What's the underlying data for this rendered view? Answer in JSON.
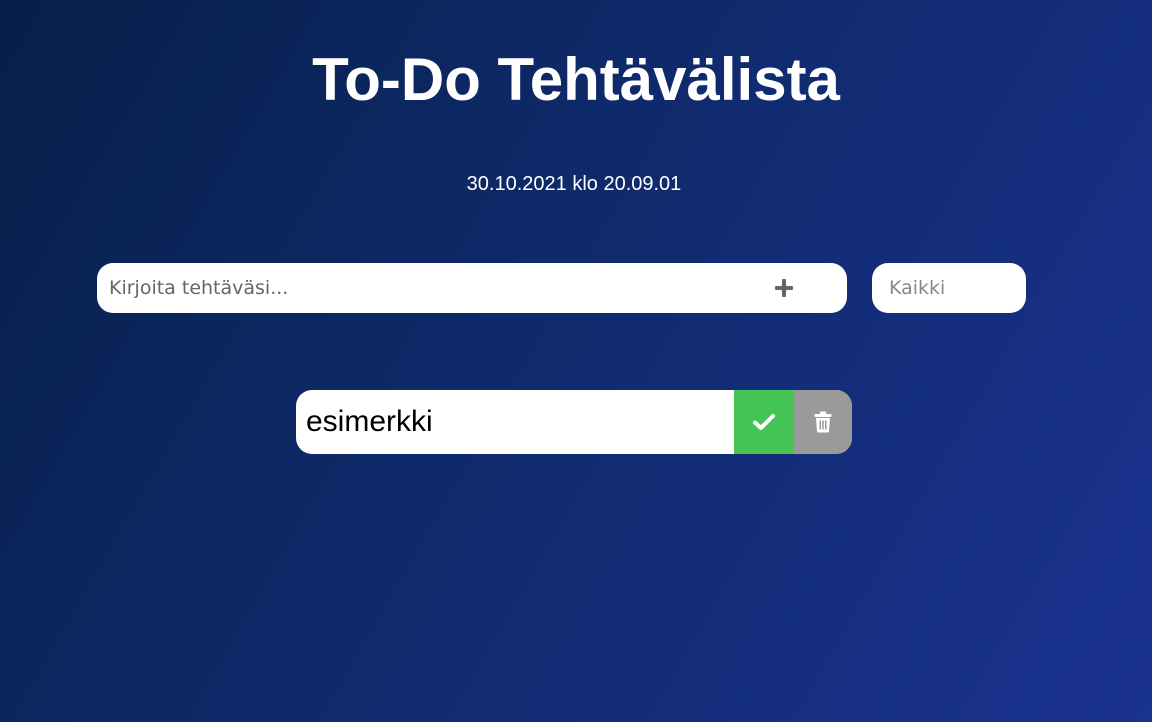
{
  "header": {
    "title": "To-Do Tehtävälista",
    "datetime": "30.10.2021 klo 20.09.01"
  },
  "form": {
    "input_placeholder": "Kirjoita tehtäväsi...",
    "input_value": "",
    "add_icon": "plus-icon"
  },
  "filter": {
    "selected": "Kaikki"
  },
  "todos": [
    {
      "text": "esimerkki",
      "complete_icon": "check-icon",
      "delete_icon": "trash-icon"
    }
  ],
  "colors": {
    "background_start": "#06204a",
    "background_end": "#1a3290",
    "complete": "#44c454",
    "delete": "#9a9a9a",
    "add_icon": "#666666"
  }
}
